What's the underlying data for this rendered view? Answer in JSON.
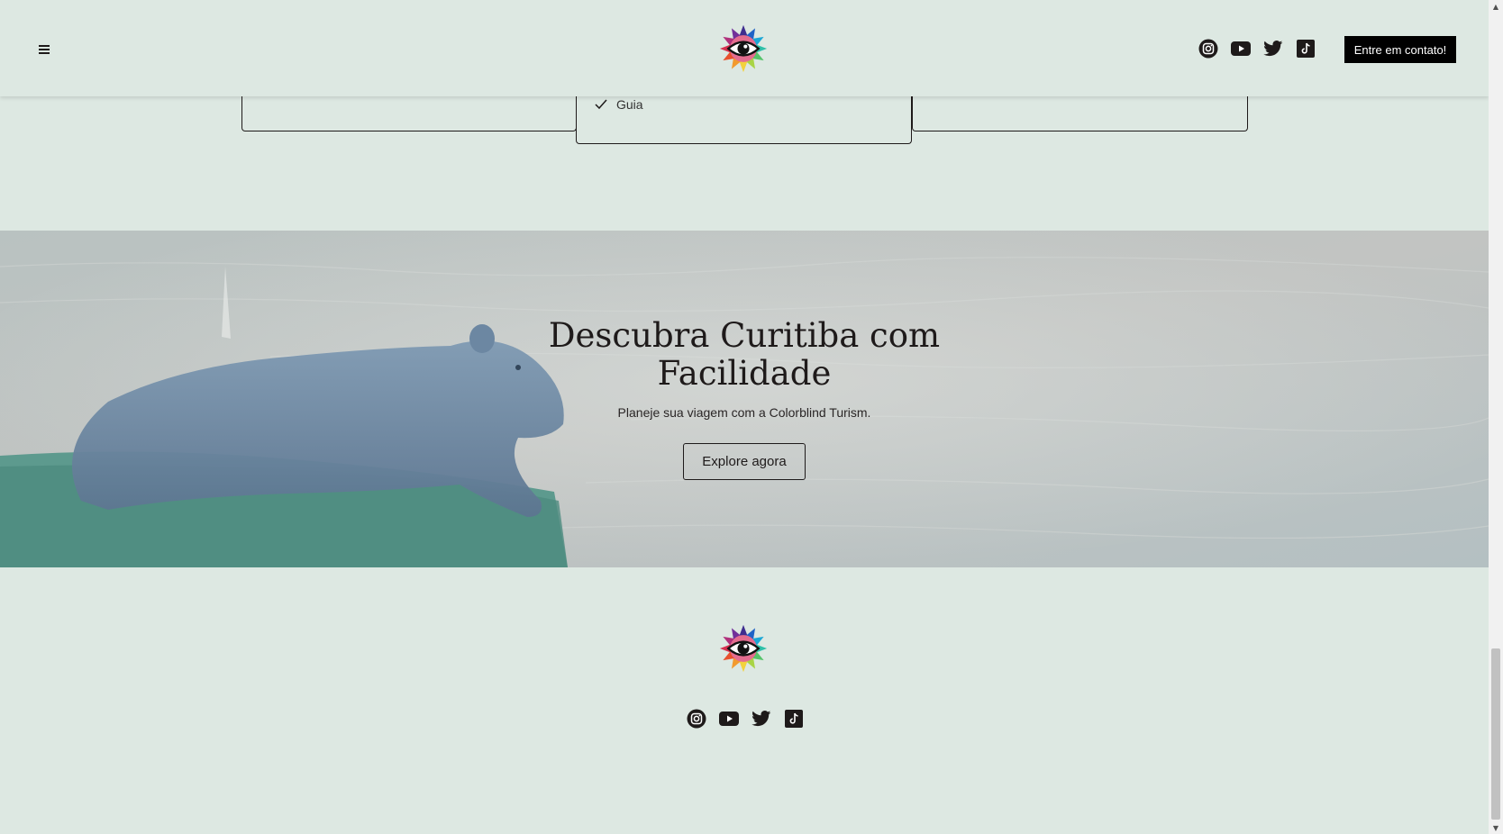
{
  "header": {
    "menu_icon": "hamburger-menu-icon",
    "logo_icon": "rainbow-eye-logo",
    "social_icons": [
      "instagram-icon",
      "youtube-icon",
      "twitter-icon",
      "tiktok-icon"
    ],
    "cta_label": "Entre em contato!"
  },
  "pricing": {
    "featured_item": "Guia",
    "featured_icon": "check-icon"
  },
  "hero": {
    "title": "Descubra Curitiba com Facilidade",
    "subtitle": "Planeje sua viagem com a Colorblind Turism.",
    "button_label": "Explore agora",
    "image_subject": "capybara-by-water"
  },
  "footer": {
    "logo_icon": "rainbow-eye-logo",
    "social_icons": [
      "instagram-icon",
      "youtube-icon",
      "twitter-icon",
      "tiktok-icon"
    ]
  },
  "colors": {
    "background": "#dde8e2",
    "text": "#1e1a1a",
    "cta_background": "#000000",
    "cta_text": "#ffffff"
  }
}
